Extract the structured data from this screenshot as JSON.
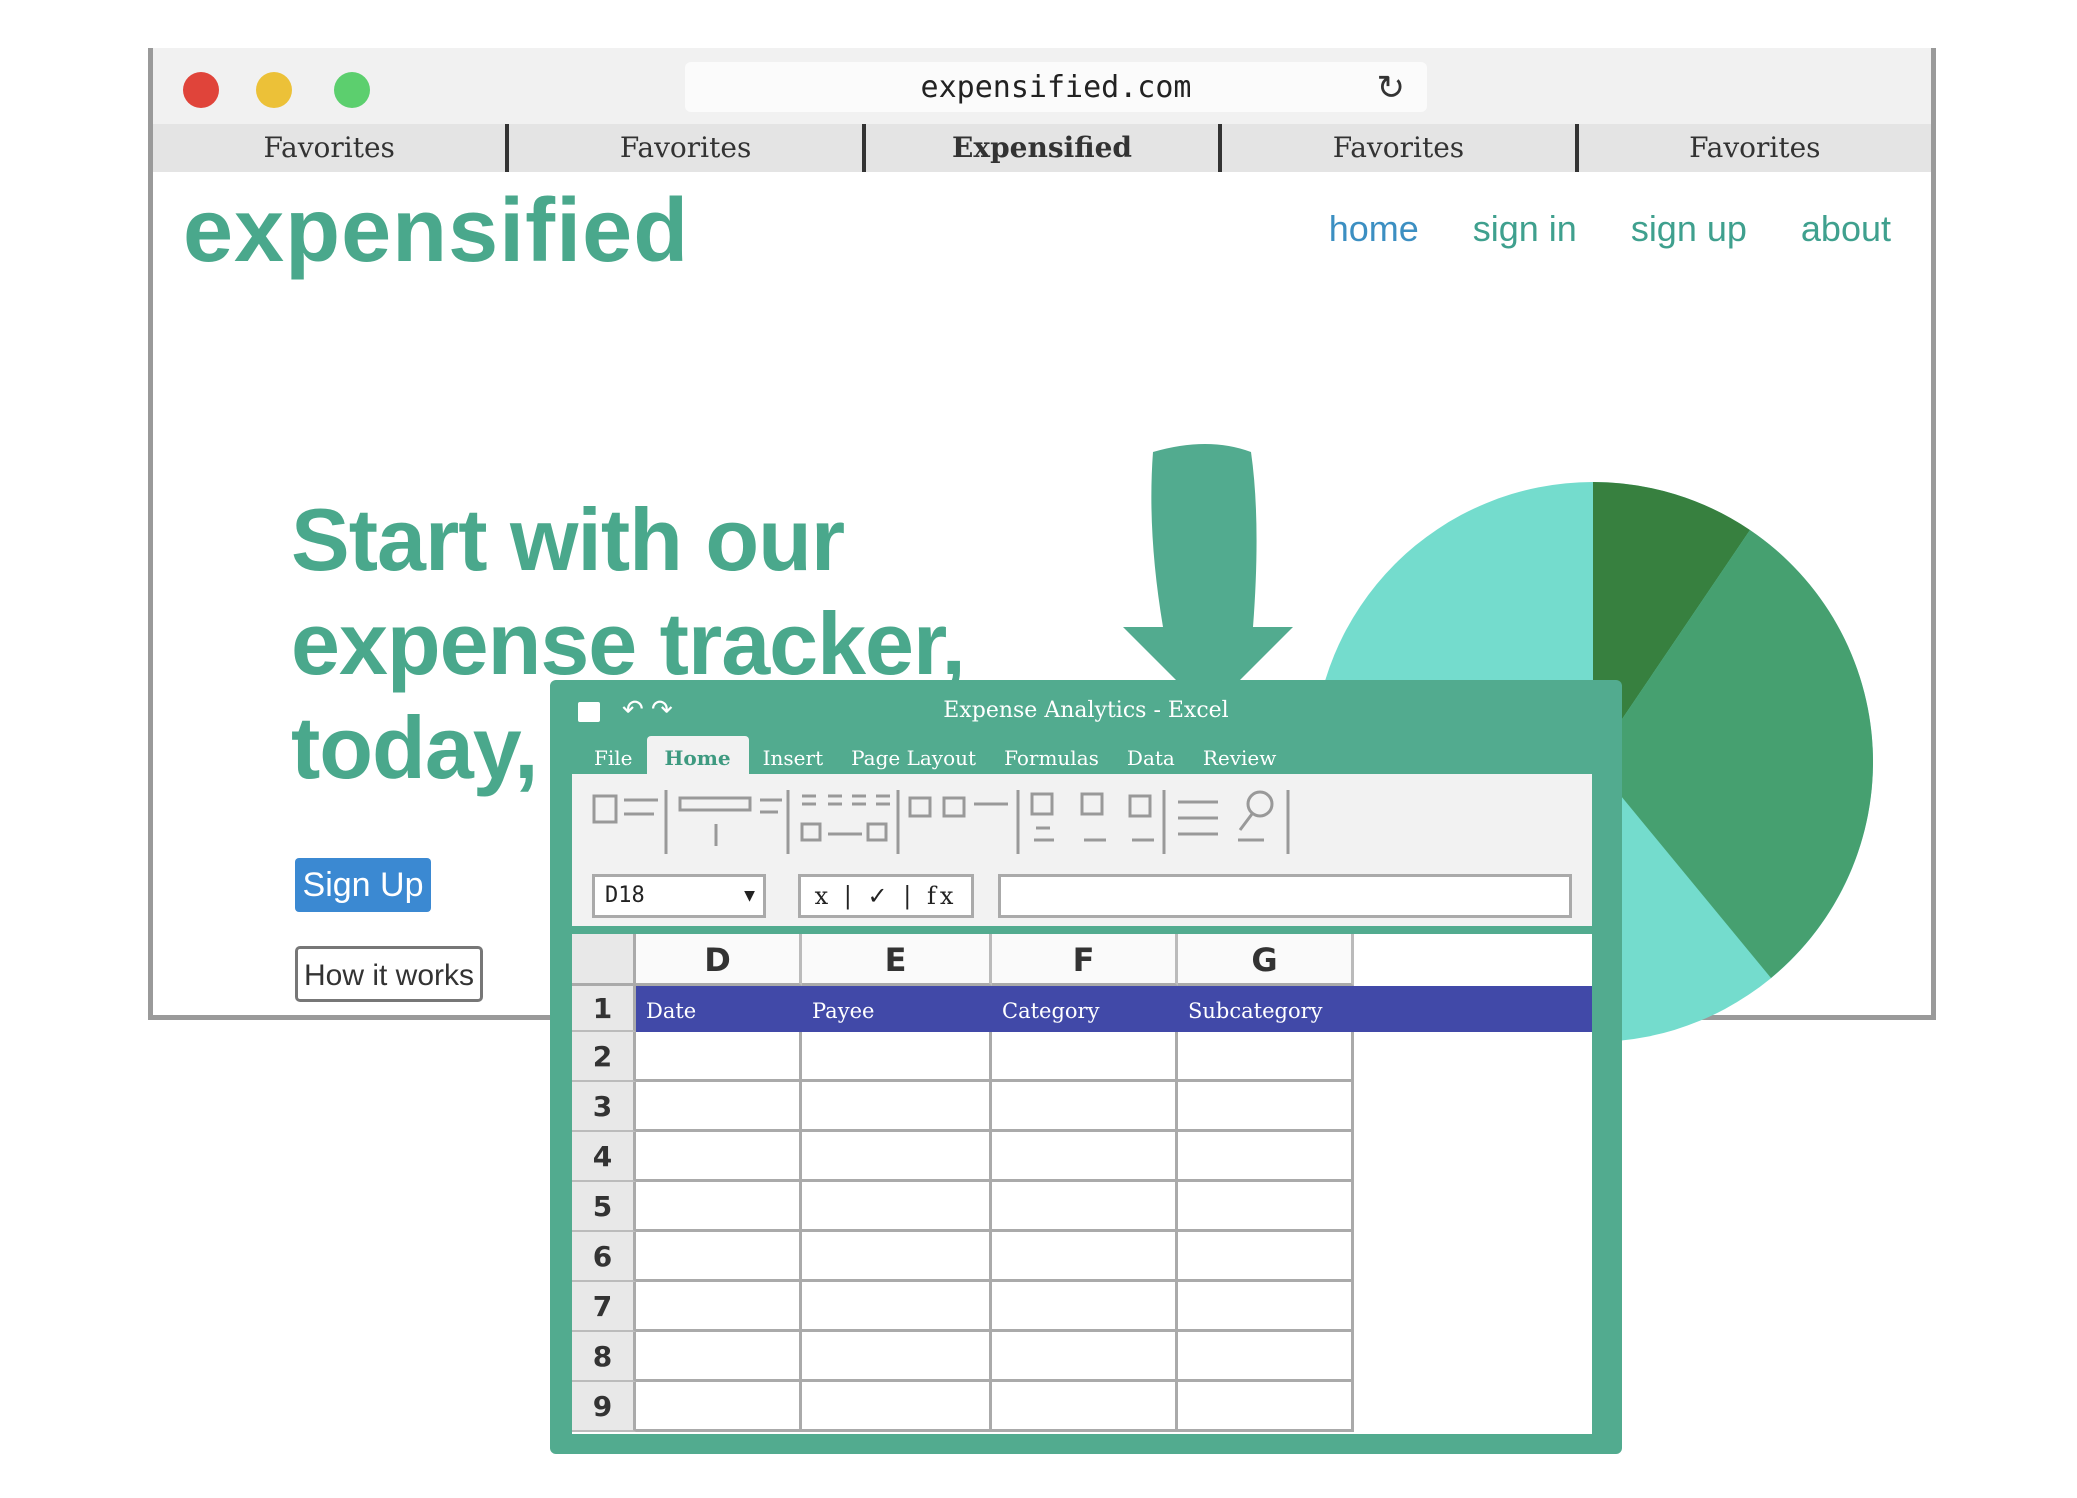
{
  "browser": {
    "url": "expensified.com",
    "tabs": [
      "Favorites",
      "Favorites",
      "Expensified",
      "Favorites",
      "Favorites"
    ],
    "active_tab": 2
  },
  "site": {
    "logo": "expensified",
    "nav": [
      "home",
      "sign in",
      "sign up",
      "about"
    ],
    "hero": "Start with our expense tracker, today, f",
    "hero_lines": [
      "Start with our",
      "expense tracker,",
      "today,"
    ],
    "signup_label": "Sign Up",
    "how_label": "How it works"
  },
  "excel": {
    "title": "Expense Analytics - Excel",
    "ribbon_tabs": [
      "File",
      "Home",
      "Insert",
      "Page Layout",
      "Formulas",
      "Data",
      "Review"
    ],
    "active_ribbon_tab": "Home",
    "name_box": "D18",
    "fx_controls": "x | ✓ | fx",
    "columns": [
      "D",
      "E",
      "F",
      "G"
    ],
    "rows": [
      "1",
      "2",
      "3",
      "4",
      "5",
      "6",
      "7",
      "8",
      "9"
    ],
    "header_cells": [
      "Date",
      "Payee",
      "Category",
      "Subcategory"
    ]
  },
  "colors": {
    "brand_green": "#4aa88c",
    "link_blue": "#3c8fc2",
    "button_blue": "#3b89d2",
    "excel_frame": "#52ab8f",
    "header_row": "#4149a8",
    "pie_light": "#74dccd",
    "pie_mid": "#46a070",
    "pie_dark": "#37803f"
  }
}
